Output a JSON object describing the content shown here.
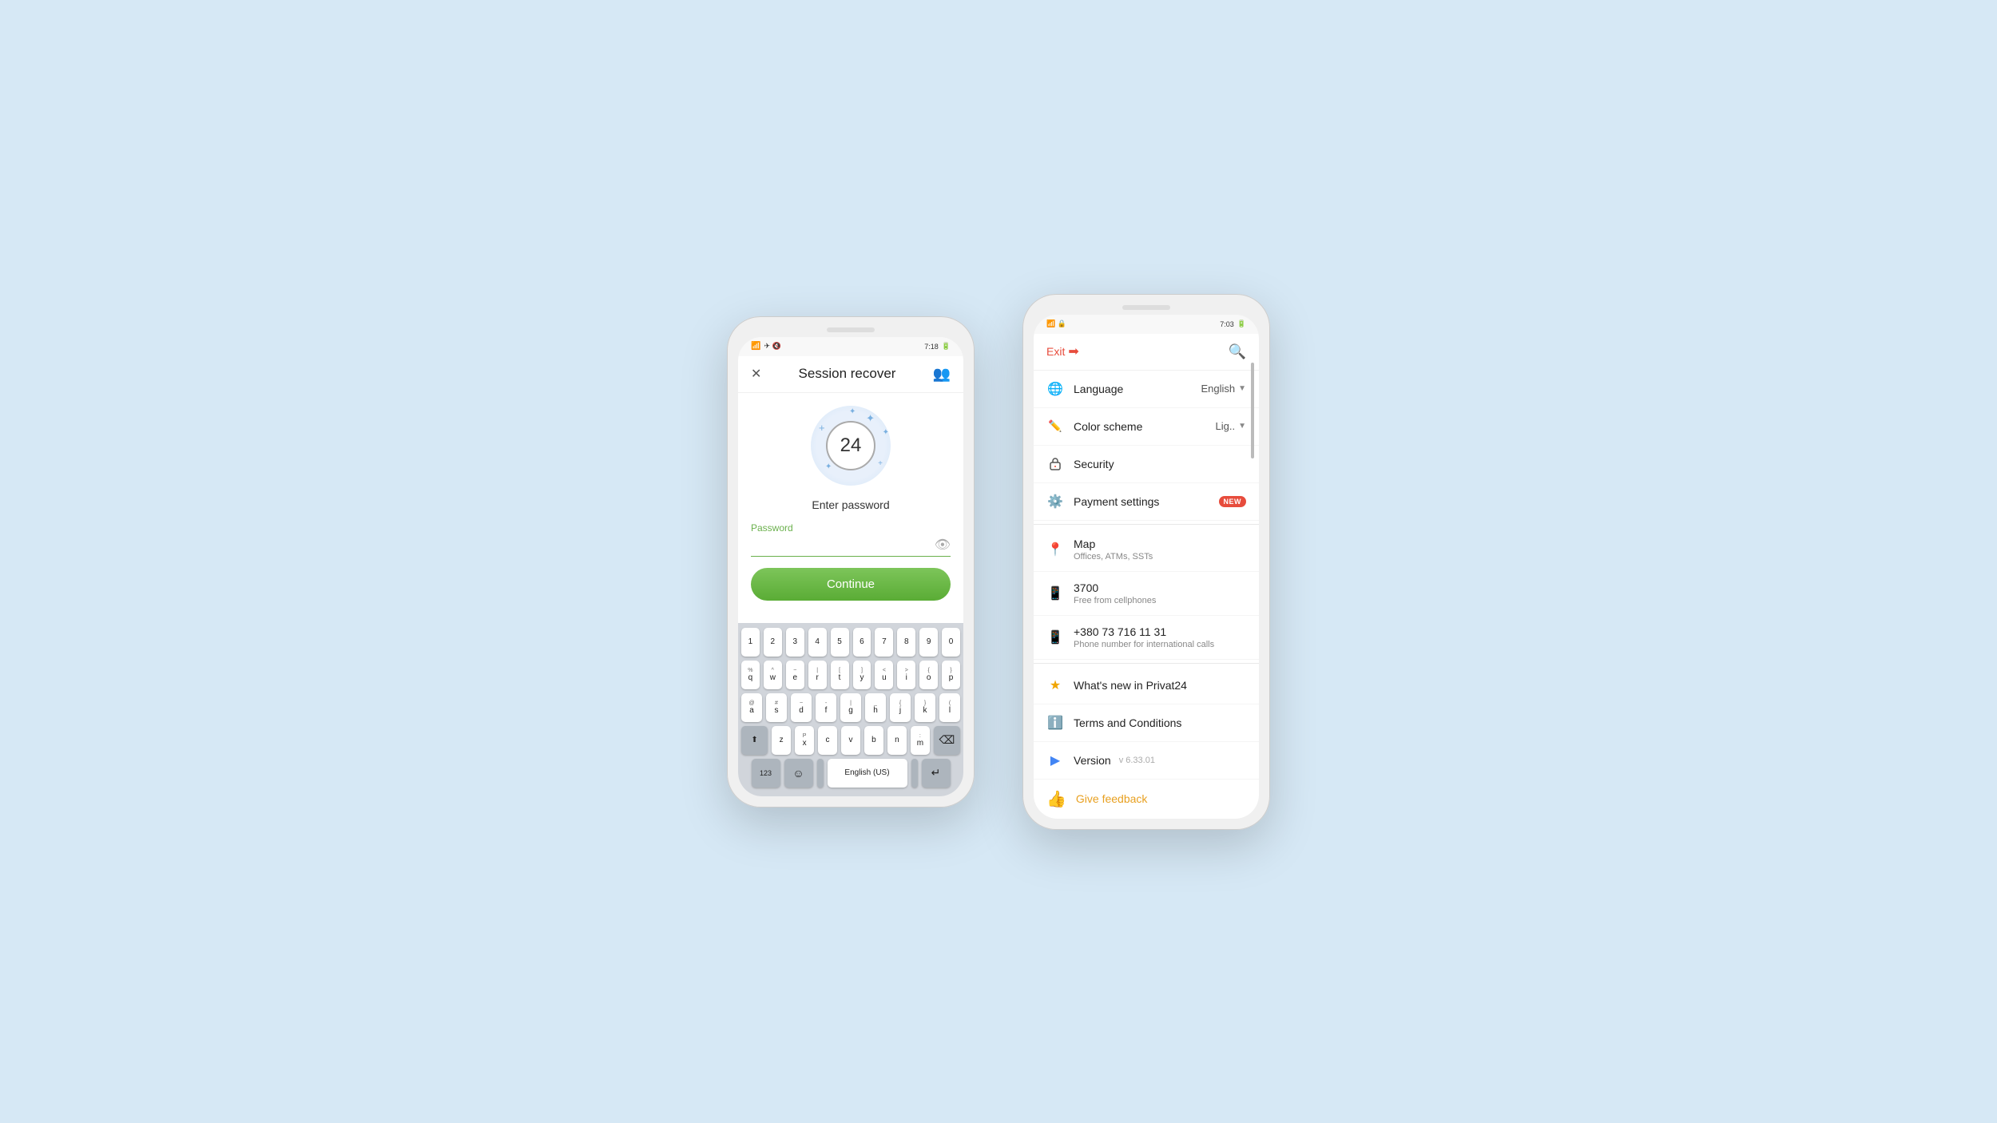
{
  "bg_color": "#d6e8f5",
  "left_phone": {
    "status_bar": {
      "left": "📶 🔋",
      "time": "7:18",
      "icons": "📶 🔋"
    },
    "header": {
      "close_label": "✕",
      "title": "Session recover",
      "avatar_icon": "👥"
    },
    "clock": {
      "number": "24"
    },
    "enter_password": "Enter password",
    "password_label": "Password",
    "password_placeholder": "",
    "continue_label": "Continue",
    "keyboard": {
      "row1": [
        "1",
        "2",
        "3",
        "4",
        "5",
        "6",
        "7",
        "8",
        "9",
        "0"
      ],
      "row2_alt": [
        "%",
        "^",
        "~",
        "|",
        "[",
        "]",
        "<",
        ">",
        "{",
        "}"
      ],
      "row2": [
        "q",
        "w",
        "e",
        "r",
        "t",
        "y",
        "u",
        "i",
        "o",
        "p"
      ],
      "row3_alt": [
        "@",
        "#",
        "~",
        "-",
        "|",
        "_",
        "{",
        "}",
        "(",
        ")",
        "`"
      ],
      "row3": [
        "a",
        "s",
        "d",
        "f",
        "g",
        "h",
        "j",
        "k",
        "l"
      ],
      "row4_alt": [
        "",
        "",
        "P",
        "",
        "",
        "",
        "/",
        "",
        ""
      ],
      "row4": [
        "z",
        "x",
        "c",
        "v",
        "b",
        "n",
        "m"
      ],
      "spacebar_label": "English (US)",
      "lang_label": "123",
      "emoji_label": "☺"
    }
  },
  "right_phone": {
    "status_bar": {
      "time": "7:03"
    },
    "header": {
      "exit_label": "Exit",
      "search_icon": "🔍"
    },
    "menu_items": [
      {
        "icon": "🌐",
        "label": "Language",
        "right": "English",
        "has_dropdown": true,
        "sublabel": ""
      },
      {
        "icon": "✏️",
        "label": "Color scheme",
        "right": "Lig..",
        "has_dropdown": true,
        "sublabel": ""
      },
      {
        "icon": "🔒",
        "label": "Security",
        "right": "",
        "has_dropdown": false,
        "sublabel": ""
      },
      {
        "icon": "⚙️",
        "label": "Payment settings",
        "badge": "NEW",
        "right": "",
        "has_dropdown": false,
        "sublabel": ""
      },
      {
        "icon": "📍",
        "label": "Map",
        "right": "",
        "has_dropdown": false,
        "sublabel": "Offices, ATMs, SSTs"
      },
      {
        "icon": "📱",
        "label": "3700",
        "right": "",
        "has_dropdown": false,
        "sublabel": "Free from cellphones"
      },
      {
        "icon": "📱",
        "label": "+380 73 716 11 31",
        "right": "",
        "has_dropdown": false,
        "sublabel": "Phone number for international calls"
      },
      {
        "icon": "⭐",
        "label": "What's new in Privat24",
        "right": "",
        "has_dropdown": false,
        "sublabel": "",
        "is_star": true
      },
      {
        "icon": "ℹ️",
        "label": "Terms and Conditions",
        "right": "",
        "has_dropdown": false,
        "sublabel": ""
      },
      {
        "icon": "▶️",
        "label": "Version",
        "version": "v 6.33.01",
        "right": "",
        "has_dropdown": false,
        "sublabel": "",
        "is_playstore": true
      }
    ],
    "feedback": {
      "label": "Give feedback",
      "icon": "👍"
    }
  }
}
